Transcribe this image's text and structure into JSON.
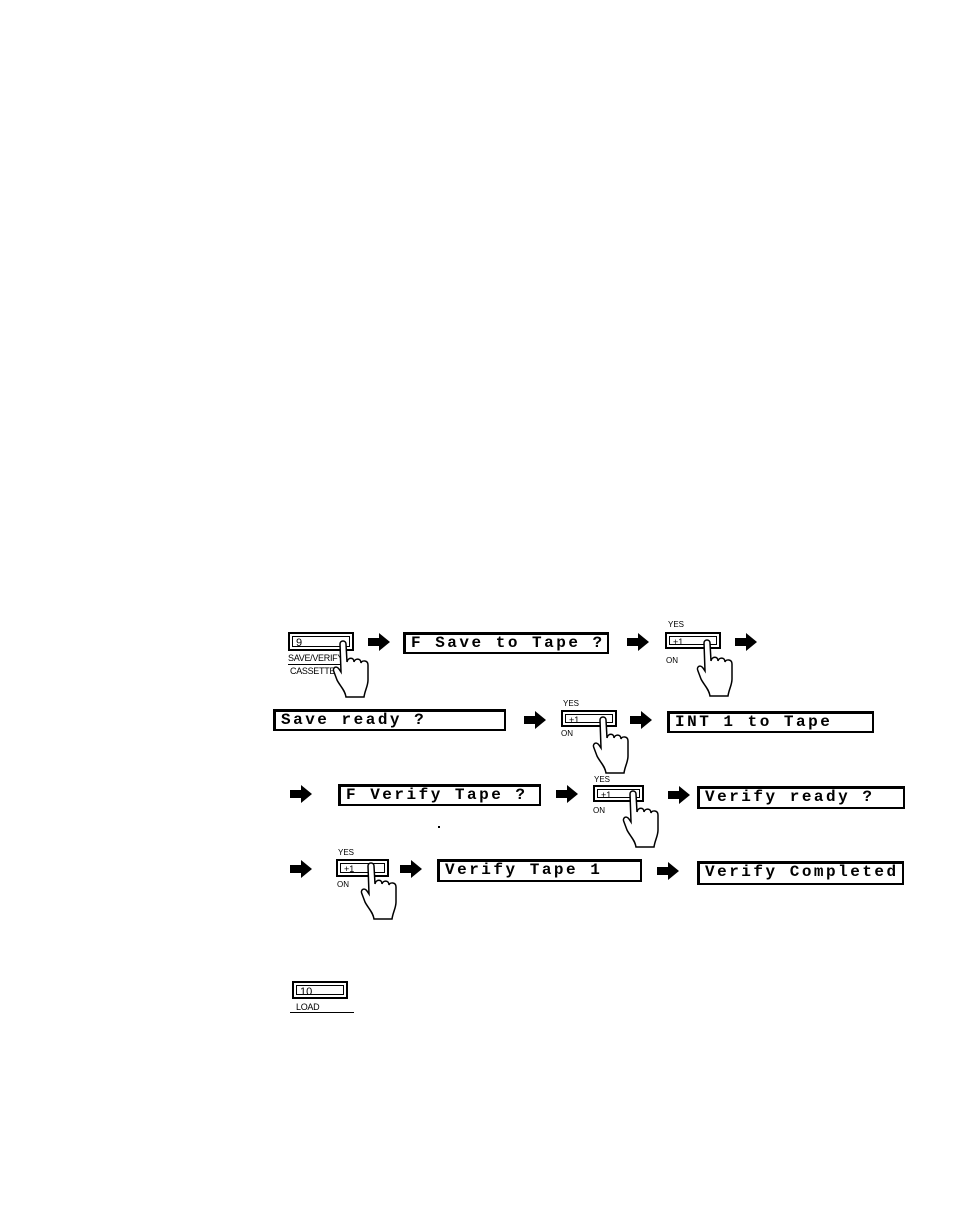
{
  "buttons": {
    "save_verify": {
      "number": "9",
      "label_top": "SAVE/VERIFY",
      "label_bottom": "CASSETTE"
    },
    "yes_on": {
      "face": "+1",
      "top": "YES",
      "bottom": "ON"
    },
    "load": {
      "number": "10",
      "label": "LOAD"
    }
  },
  "displays": {
    "f_save_to_tape": "F Save to Tape ?",
    "save_ready": "Save ready ?",
    "int_to_tape": "INT 1 to Tape",
    "f_verify_tape": "F Verify Tape ?",
    "verify_ready": "Verify ready ?",
    "verify_tape": "Verify Tape 1",
    "verify_completed": "Verify Completed"
  },
  "icons": {
    "arrow": "right-arrow-icon",
    "hand": "pointing-hand-icon"
  }
}
